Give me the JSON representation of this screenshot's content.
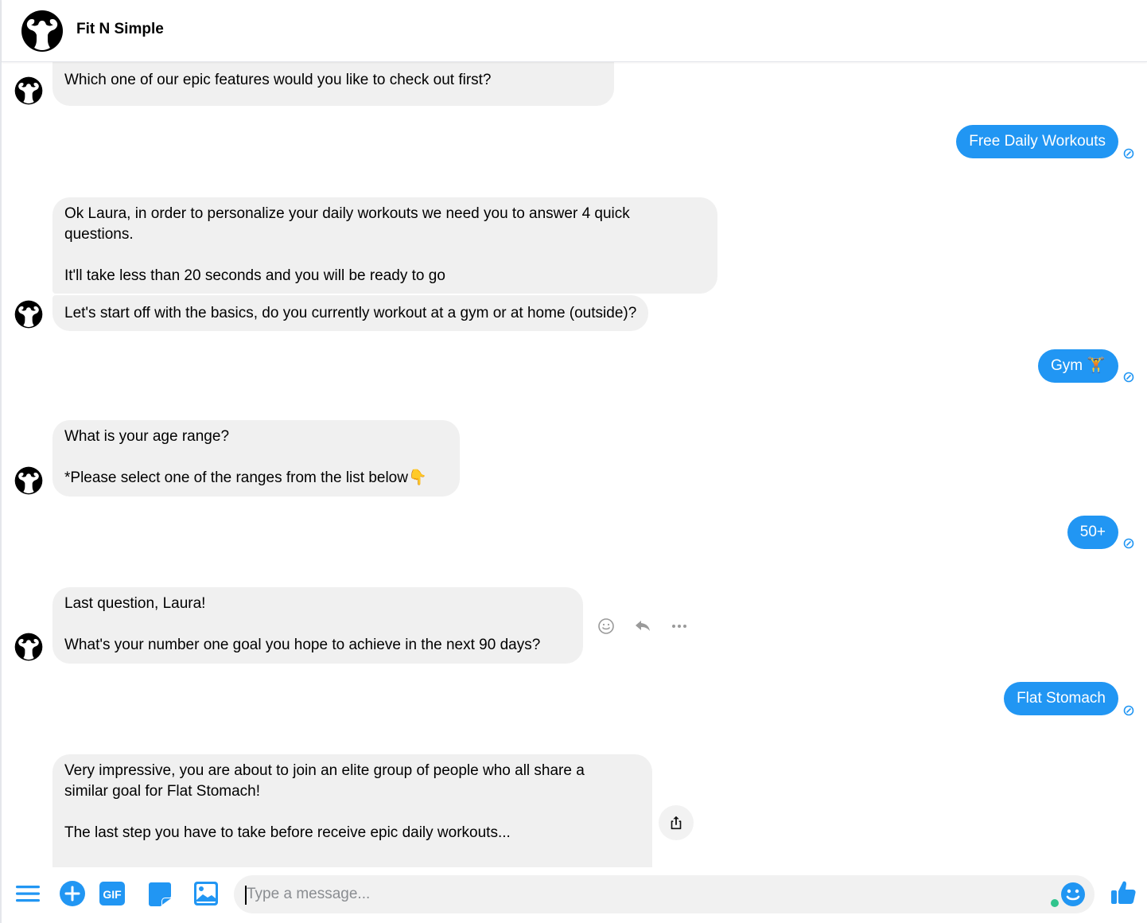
{
  "header": {
    "title": "Fit N Simple",
    "logo_icon": "bodybuilder-logo-icon"
  },
  "messages": [
    {
      "from": "bot",
      "text": "Which one of our epic features would you like to check out first?"
    },
    {
      "from": "user",
      "text": "Free Daily Workouts",
      "status": "seen"
    },
    {
      "from": "bot",
      "text": "Ok Laura, in order to personalize your daily workouts we need you to answer 4 quick\nquestions.\n\nIt'll take less than 20 seconds and you will be ready to go"
    },
    {
      "from": "bot",
      "text": "Let's start off with the basics, do you currently workout at a gym or at home (outside)?"
    },
    {
      "from": "user",
      "text": "Gym 🏋",
      "status": "seen"
    },
    {
      "from": "bot",
      "text": "What is your age range?\n\n*Please select one of the ranges from the list below👇"
    },
    {
      "from": "user",
      "text": "50+",
      "status": "seen"
    },
    {
      "from": "bot",
      "text": "Last question, Laura!\n\nWhat's your number one goal you hope to achieve in the next 90 days?"
    },
    {
      "from": "user",
      "text": "Flat Stomach",
      "status": "seen"
    },
    {
      "from": "bot",
      "text": "Very impressive, you are about to join an elite group of people who all share a\nsimilar goal for Flat Stomach!\n\nThe last step you have to take before receive epic daily workouts..."
    }
  ],
  "message_actions": [
    "react-icon",
    "reply-icon",
    "more-icon"
  ],
  "composer": {
    "placeholder": "Type a message...",
    "value": "",
    "icons": [
      "menu-icon",
      "add-icon",
      "gif-icon",
      "sticker-icon",
      "photo-icon",
      "emoji-icon",
      "like-icon"
    ],
    "gif_label": "GIF"
  },
  "colors": {
    "accent": "#2196f3",
    "incoming_bubble": "#f0f0f0",
    "online_dot": "#31c48d"
  }
}
